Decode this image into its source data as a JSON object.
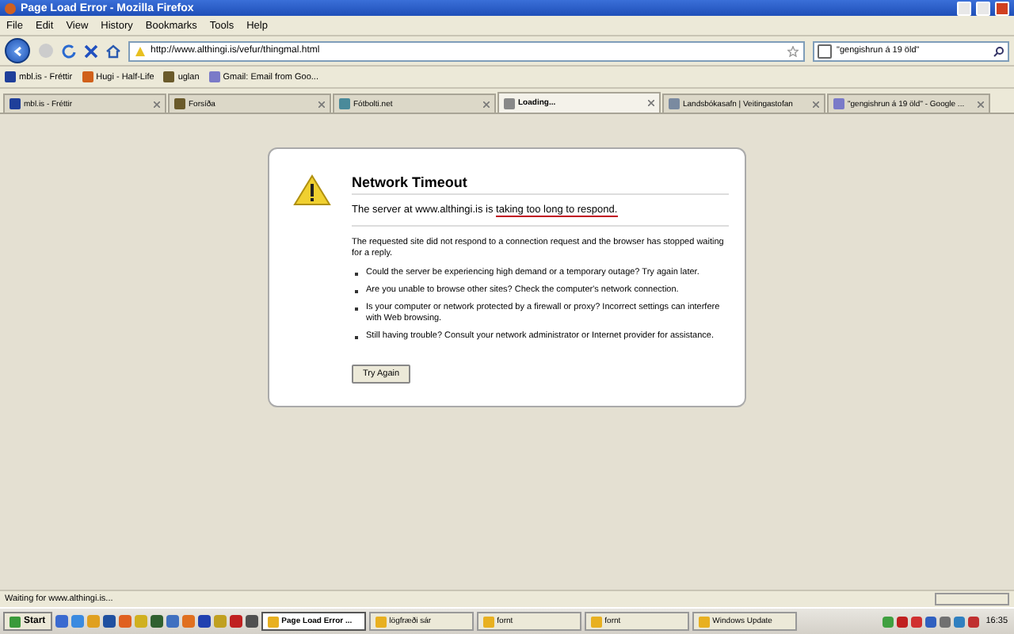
{
  "window": {
    "title": "Page Load Error - Mozilla Firefox"
  },
  "menu": [
    "File",
    "Edit",
    "View",
    "History",
    "Bookmarks",
    "Tools",
    "Help"
  ],
  "navbar": {
    "url": "http://www.althingi.is/vefur/thingmal.html",
    "search": "\"gengishrun á 19 öld\""
  },
  "bookmarks": [
    {
      "label": "mbl.is - Fréttir",
      "color": "#1f3f9a"
    },
    {
      "label": "Hugi - Half-Life",
      "color": "#d0601a"
    },
    {
      "label": "uglan",
      "color": "#6a5a2a"
    },
    {
      "label": "Gmail: Email from Goo...",
      "color": "#7a7ac8"
    }
  ],
  "tabs": [
    {
      "label": "mbl.is - Fréttir",
      "selected": false,
      "color": "#1f3f9a"
    },
    {
      "label": "Forsíða",
      "selected": false,
      "color": "#6a5a2a"
    },
    {
      "label": "Fótbolti.net",
      "selected": false,
      "color": "#4a8a9a"
    },
    {
      "label": "Loading...",
      "selected": true,
      "color": "#888888"
    },
    {
      "label": "Landsbókasafn | Veitingastofan",
      "selected": false,
      "color": "#7a8aa0"
    },
    {
      "label": "\"gengishrun á 19 öld\" - Google ...",
      "selected": false,
      "color": "#7a7ac8"
    }
  ],
  "error": {
    "title": "Network Timeout",
    "summary_prefix": "The server at www.althingi.is is",
    "summary_link": "taking too long to respond.",
    "description": "The requested site did not respond to a connection request and the browser has stopped waiting for a reply.",
    "bullets": [
      "Could the server be experiencing high demand or a temporary outage? Try again later.",
      "Are you unable to browse other sites? Check the computer's network connection.",
      "Is your computer or network protected by a firewall or proxy? Incorrect settings can interfere with Web browsing.",
      "Still having trouble? Consult your network administrator or Internet provider for assistance."
    ],
    "button": "Try Again"
  },
  "status_bar": {
    "text": "Waiting for www.althingi.is..."
  },
  "taskbar": {
    "start": "Start",
    "tasks": [
      {
        "label": "Page Load Error ...",
        "selected": true
      },
      {
        "label": "lögfræði sár",
        "selected": false
      },
      {
        "label": "fornt",
        "selected": false
      },
      {
        "label": "fornt",
        "selected": false
      },
      {
        "label": "Windows Update",
        "selected": false
      }
    ],
    "clock": "16:35"
  }
}
